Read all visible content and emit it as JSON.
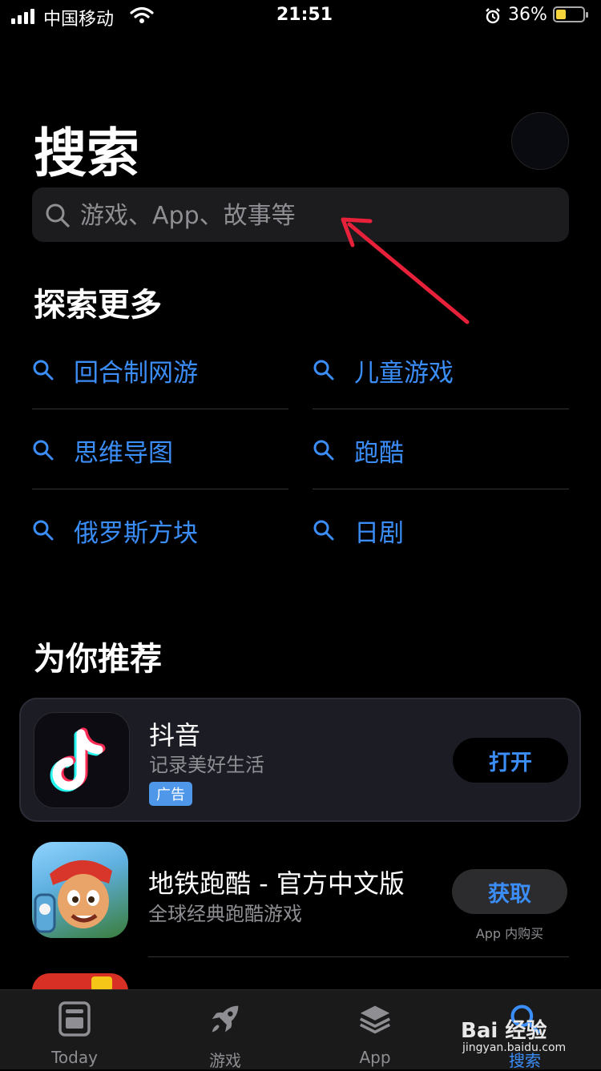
{
  "status_bar": {
    "carrier": "中国移动",
    "time": "21:51",
    "battery": "36%"
  },
  "header": {
    "title": "搜索"
  },
  "search": {
    "placeholder": "游戏、App、故事等"
  },
  "explore": {
    "title": "探索更多",
    "items": [
      "回合制网游",
      "儿童游戏",
      "思维导图",
      "跑酷",
      "俄罗斯方块",
      "日剧"
    ]
  },
  "recommend": {
    "title": "为你推荐",
    "apps": [
      {
        "name": "抖音",
        "subtitle": "记录美好生活",
        "badge": "广告",
        "button": "打开"
      },
      {
        "name": "地铁跑酷 - 官方中文版",
        "subtitle": "全球经典跑酷游戏",
        "button": "获取",
        "note": "App 内购买"
      }
    ]
  },
  "tabbar": {
    "tabs": [
      {
        "label": "Today",
        "icon": "today-icon"
      },
      {
        "label": "游戏",
        "icon": "rocket-icon"
      },
      {
        "label": "App",
        "icon": "layers-icon"
      },
      {
        "label": "搜索",
        "icon": "search-icon"
      }
    ],
    "active": "搜索"
  },
  "watermark": {
    "brand": "Bai 经验",
    "url": "jingyan.baidu.com"
  },
  "colors": {
    "accent": "#3b8df7",
    "annotation_arrow": "#e8213a",
    "background": "#000000"
  }
}
